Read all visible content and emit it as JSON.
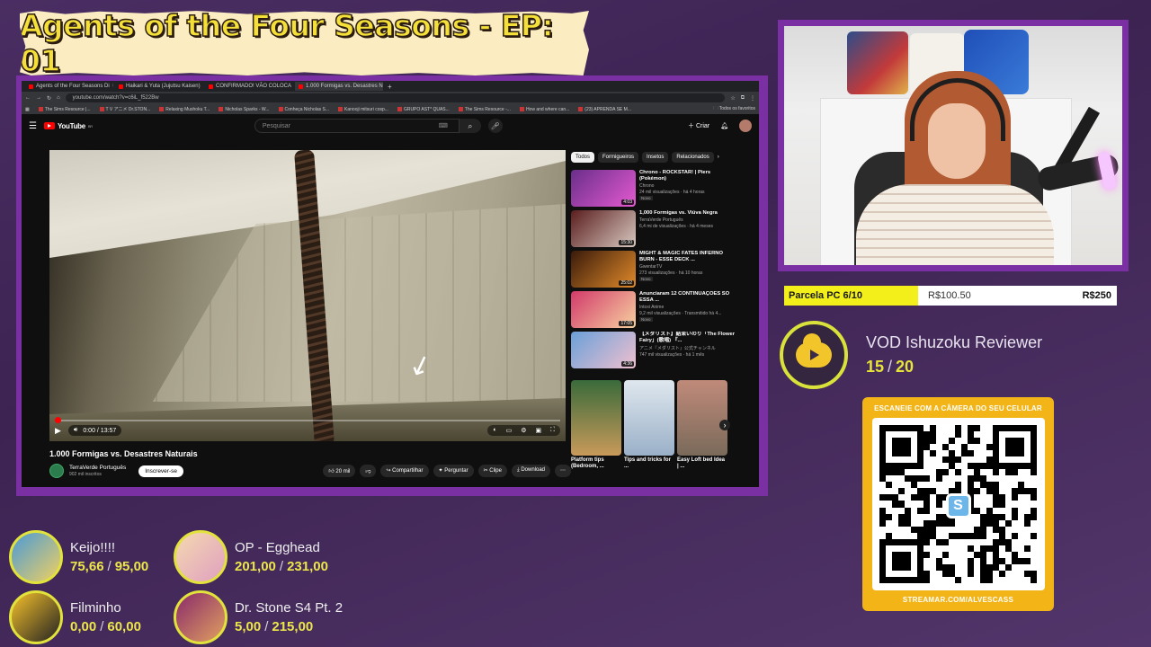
{
  "banner": {
    "title": "Agents of the Four Seasons - EP: 01"
  },
  "browser": {
    "tabs": [
      "Agents of the Four Seasons Di",
      "Haikari & Yuta (Jujutsu Kaisen)",
      "CONFIRMADO! VÃO COLOCA",
      "1.000 Formigas vs. Desastres N"
    ],
    "active_tab": 3,
    "url": "youtube.com/watch?v=c6iL_f522Bw",
    "bookmarks": [
      "The Sims Resource |...",
      "T V アニメ Dr.STON...",
      "Relaxing Mushoku T...",
      "Nicholas Sparks - W...",
      "Conheça Nicholas S...",
      "Kanooji mitsuri cosp...",
      "GRUPO AST* QUAS...",
      "The Sims Resource -...",
      "How and where can...",
      "(23) APRENDA SE M...",
      "Todos os favoritos"
    ]
  },
  "youtube": {
    "logo": "YouTube",
    "logo_country": "BR",
    "search_placeholder": "Pesquisar",
    "create_label": "Criar",
    "player": {
      "time": "0:00 / 13:57",
      "progress": 0.01
    },
    "video_title": "1.000 Formigas vs. Desastres Naturais",
    "channel": {
      "name": "TerraVerde Português",
      "subs": "902 mil inscritos",
      "subscribe_label": "Inscrever-se"
    },
    "actions": {
      "likes": "20 mil",
      "share": "Compartilhar",
      "ask": "Perguntar",
      "clip": "Clipe",
      "download": "Download"
    },
    "chips": [
      "Todos",
      "Formigueiros",
      "Insetos",
      "Relacionados"
    ],
    "recommendations": [
      {
        "title": "Chrono - ROCKSTAR! | Piers (Pokémon)",
        "channel": "Chrono",
        "meta": "24 mil visualizações · há 4 horas",
        "badge": "Novo",
        "duration": "4:03",
        "colors": [
          "#6a2e8a",
          "#e45ad0"
        ]
      },
      {
        "title": "1,000 Formigas vs. Viúva Negra",
        "channel": "TerraVerde Português",
        "meta": "6,4 mi de visualizações · há 4 meses",
        "badge": "",
        "duration": "15:30",
        "colors": [
          "#5a1e1e",
          "#d8c8c0"
        ]
      },
      {
        "title": "MIGHT & MAGIC FATES INFERNO BURN - ESSE DECK ...",
        "channel": "GwentarTV",
        "meta": "273 visualizações · há 10 horas",
        "badge": "Novo",
        "duration": "25:02",
        "colors": [
          "#3a1a0a",
          "#e08a2a"
        ]
      },
      {
        "title": "Anunciaram 12 CONTINUAÇÕES SÓ ESSA ...",
        "channel": "Intoxi Anime",
        "meta": "9,2 mil visualizações · Transmitido há 4...",
        "badge": "Novo",
        "duration": "17:05",
        "colors": [
          "#d23a6a",
          "#f7d0a0"
        ]
      },
      {
        "title": "【メダリスト】結束いのり「The Flower Fairy」(歌唱) 『...",
        "channel": "アニメ『メダリスト』公式チャンネル",
        "meta": "747 mil visualizações · há 1 mês",
        "badge": "",
        "duration": "4:36",
        "colors": [
          "#6aa0d8",
          "#f0c0d0"
        ]
      }
    ],
    "shorts": [
      {
        "title": "Platform tips (Bedroom, ...",
        "colors": [
          "#3a6a3a",
          "#c89a5a"
        ]
      },
      {
        "title": "Tips and tricks for ...",
        "colors": [
          "#dfe7ee",
          "#9ab0c8"
        ]
      },
      {
        "title": "Easy Loft bed Idea | ...",
        "colors": [
          "#c08a7a",
          "#7a6a5a"
        ]
      }
    ]
  },
  "goal_bar": {
    "label": "Parcela PC 6/10",
    "current": "R$100.50",
    "target": "R$250",
    "progress": 0.402
  },
  "vod": {
    "title": "VOD Ishuzoku Reviewer",
    "current": "15",
    "sep": "/",
    "target": "20"
  },
  "qr": {
    "heading": "ESCANEIE COM A CÂMERA DO SEU CELULAR",
    "url": "STREAMAR.COM/ALVESCASS",
    "logo_letter": "S"
  },
  "goals": [
    {
      "name": "Keijo!!!!",
      "current": "75,66",
      "sep": "/",
      "target": "95,00",
      "colors": [
        "#4a9ad8",
        "#f0d060"
      ]
    },
    {
      "name": "OP - Egghead",
      "current": "201,00",
      "sep": "/",
      "target": "231,00",
      "colors": [
        "#f4d8b0",
        "#e0a0c0"
      ]
    },
    {
      "name": "Filminho",
      "current": "0,00",
      "sep": "/",
      "target": "60,00",
      "colors": [
        "#f5c02a",
        "#222222"
      ]
    },
    {
      "name": "Dr. Stone S4 Pt. 2",
      "current": "5,00",
      "sep": "/",
      "target": "215,00",
      "colors": [
        "#8a2a6a",
        "#e0a060"
      ]
    }
  ],
  "colors": {
    "frame_purple": "#7a2fa3",
    "accent_yellow": "#f2ef1a",
    "qr_orange": "#f2b417"
  }
}
